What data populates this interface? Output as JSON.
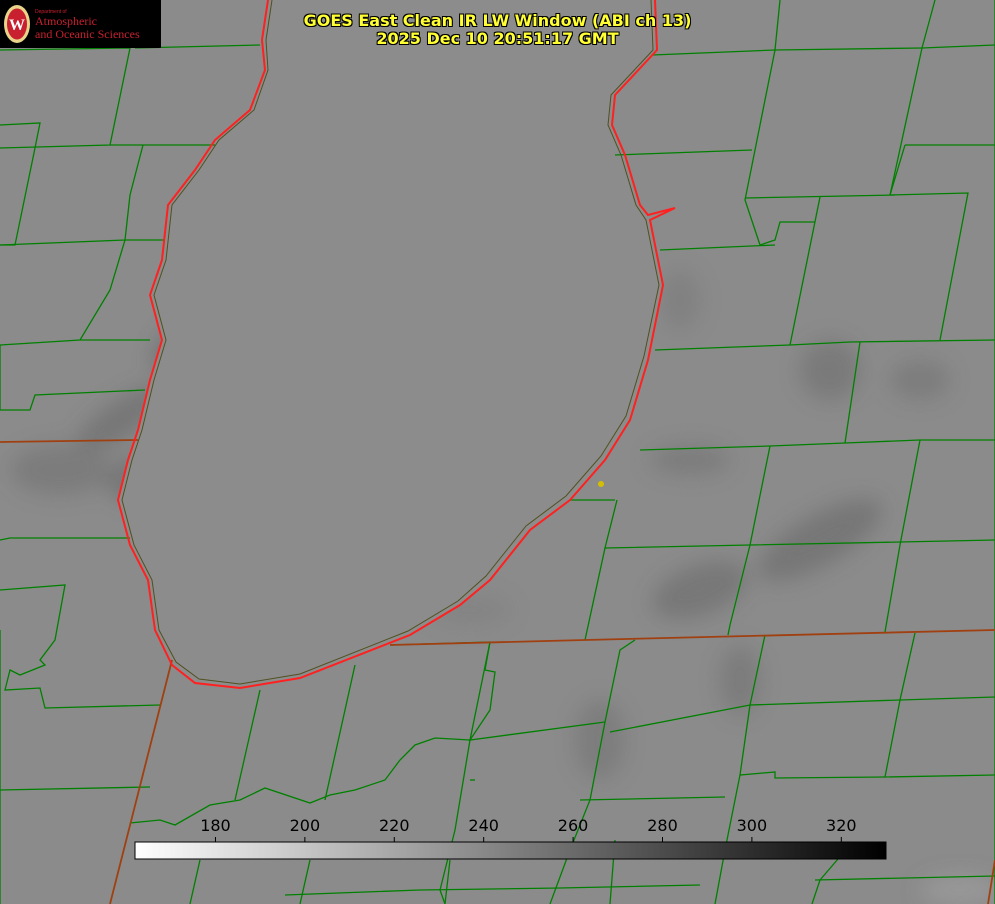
{
  "title": {
    "line1": "GOES East Clean IR LW Window (ABI ch 13)",
    "line2": "2025 Dec 10 20:51:17 GMT"
  },
  "logo": {
    "department": "Department of",
    "line1": "Atmospheric",
    "line2": "and Oceanic Sciences",
    "seal_letter": "W"
  },
  "colorbar": {
    "unit": "",
    "ticks": [
      "180",
      "200",
      "220",
      "240",
      "260",
      "280",
      "300",
      "320"
    ],
    "min_value": 162,
    "max_value": 330,
    "tick_values": [
      180,
      200,
      220,
      240,
      260,
      280,
      300,
      320
    ],
    "color_low": "#ffffff",
    "color_high": "#000000"
  },
  "colors": {
    "background_gray": "#8a8a8a",
    "lake_gray": "#8c8c8c",
    "county_lines": "#008000",
    "state_lines": "#a04010",
    "shoreline": "#ff2020",
    "title_text": "#ffff33",
    "marker": "#d4c000"
  },
  "map_features": {
    "lake": "Lake Michigan",
    "marker": "station-dot"
  }
}
